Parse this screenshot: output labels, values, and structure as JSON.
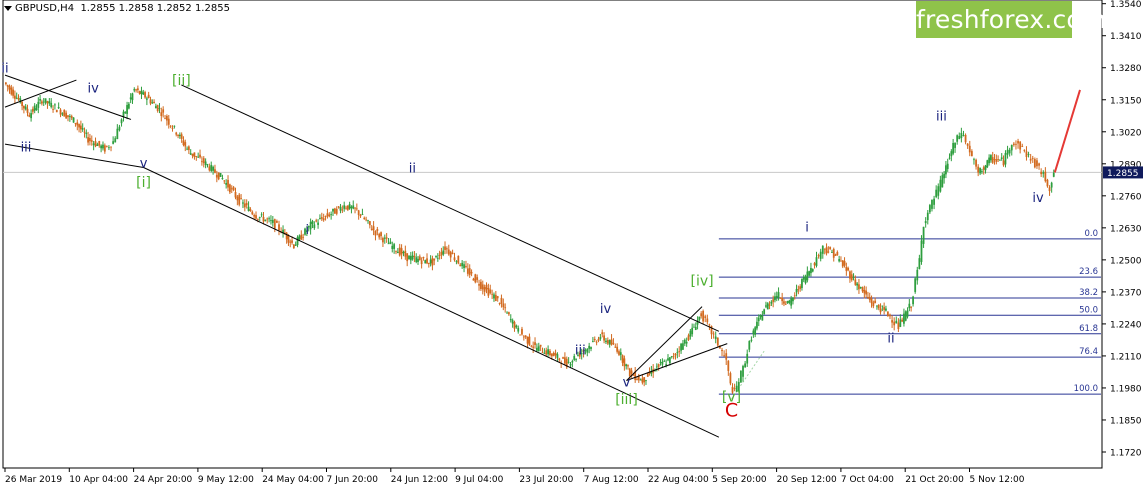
{
  "header": {
    "symbol": "GBPUSD,H4",
    "ohlc": "1.2855 1.2858 1.2852 1.2855"
  },
  "logo": {
    "text": "freshforex.com"
  },
  "colors": {
    "bull": "#2e9e3e",
    "bear": "#d2691e",
    "green_label": "#4caf2f",
    "navy_label": "#1a237e",
    "red_label": "#d50000",
    "fib_line": "#283593",
    "price_tag_bg": "#0f1a5c"
  },
  "chart_data": {
    "type": "candlestick",
    "symbol": "GBPUSD",
    "timeframe": "H4",
    "current_price": 1.2855,
    "y_range": [
      1.1655,
      1.3555
    ],
    "y_ticks": [
      "1.3540",
      "1.3410",
      "1.3280",
      "1.3150",
      "1.3020",
      "1.2890",
      "1.2760",
      "1.2630",
      "1.2500",
      "1.2370",
      "1.2240",
      "1.2110",
      "1.1980",
      "1.1850",
      "1.1720"
    ],
    "x_labels": [
      "26 Mar 2019",
      "10 Apr 04:00",
      "24 Apr 20:00",
      "9 May 12:00",
      "24 May 04:00",
      "7 Jun 20:00",
      "24 Jun 12:00",
      "9 Jul 04:00",
      "23 Jul 20:00",
      "7 Aug 12:00",
      "22 Aug 04:00",
      "5 Sep 20:00",
      "20 Sep 12:00",
      "7 Oct 04:00",
      "21 Oct 20:00",
      "5 Nov 12:00"
    ],
    "price_path": [
      [
        0,
        1.322
      ],
      [
        3,
        1.316
      ],
      [
        6,
        1.309
      ],
      [
        9,
        1.315
      ],
      [
        13,
        1.311
      ],
      [
        17,
        1.306
      ],
      [
        20,
        1.299
      ],
      [
        24,
        1.295
      ],
      [
        26,
        1.298
      ],
      [
        28,
        1.307
      ],
      [
        31,
        1.319
      ],
      [
        34,
        1.316
      ],
      [
        37,
        1.311
      ],
      [
        41,
        1.302
      ],
      [
        44,
        1.294
      ],
      [
        48,
        1.289
      ],
      [
        52,
        1.283
      ],
      [
        56,
        1.274
      ],
      [
        60,
        1.268
      ],
      [
        64,
        1.265
      ],
      [
        66,
        1.262
      ],
      [
        69,
        1.256
      ],
      [
        73,
        1.264
      ],
      [
        77,
        1.268
      ],
      [
        81,
        1.272
      ],
      [
        84,
        1.27
      ],
      [
        88,
        1.262
      ],
      [
        92,
        1.256
      ],
      [
        96,
        1.251
      ],
      [
        99,
        1.25
      ],
      [
        102,
        1.249
      ],
      [
        105,
        1.255
      ],
      [
        110,
        1.246
      ],
      [
        114,
        1.239
      ],
      [
        118,
        1.233
      ],
      [
        122,
        1.222
      ],
      [
        126,
        1.215
      ],
      [
        130,
        1.212
      ],
      [
        134,
        1.208
      ],
      [
        138,
        1.213
      ],
      [
        142,
        1.219
      ],
      [
        146,
        1.214
      ],
      [
        149,
        1.204
      ],
      [
        152,
        1.201
      ],
      [
        155,
        1.206
      ],
      [
        159,
        1.21
      ],
      [
        163,
        1.219
      ],
      [
        166,
        1.228
      ],
      [
        168,
        1.222
      ],
      [
        170,
        1.216
      ],
      [
        172,
        1.209
      ],
      [
        173,
        1.199
      ],
      [
        174,
        1.196
      ],
      [
        176,
        1.206
      ],
      [
        178,
        1.219
      ],
      [
        181,
        1.23
      ],
      [
        184,
        1.236
      ],
      [
        187,
        1.232
      ],
      [
        190,
        1.241
      ],
      [
        193,
        1.249
      ],
      [
        195,
        1.255
      ],
      [
        198,
        1.252
      ],
      [
        201,
        1.245
      ],
      [
        204,
        1.238
      ],
      [
        207,
        1.232
      ],
      [
        210,
        1.229
      ],
      [
        212,
        1.225
      ],
      [
        213,
        1.223
      ],
      [
        216,
        1.232
      ],
      [
        218,
        1.25
      ],
      [
        219,
        1.265
      ],
      [
        221,
        1.273
      ],
      [
        223,
        1.281
      ],
      [
        226,
        1.296
      ],
      [
        228,
        1.302
      ],
      [
        230,
        1.294
      ],
      [
        232,
        1.285
      ],
      [
        235,
        1.291
      ],
      [
        238,
        1.29
      ],
      [
        240,
        1.298
      ],
      [
        242,
        1.296
      ],
      [
        244,
        1.292
      ],
      [
        246,
        1.288
      ],
      [
        248,
        1.283
      ],
      [
        249,
        1.279
      ],
      [
        250,
        1.286
      ]
    ],
    "forecast": [
      [
        250,
        1.2855
      ],
      [
        256,
        1.319
      ]
    ],
    "fibonacci": [
      {
        "level": "0.0",
        "price": 1.2585
      },
      {
        "level": "23.6",
        "price": 1.243
      },
      {
        "level": "38.2",
        "price": 1.2345
      },
      {
        "level": "50.0",
        "price": 1.2275
      },
      {
        "level": "61.8",
        "price": 1.22
      },
      {
        "level": "76.4",
        "price": 1.2105
      },
      {
        "level": "100.0",
        "price": 1.1955
      }
    ],
    "wave_labels": [
      {
        "text": "ii",
        "color": "navy",
        "pt": [
          0,
          1.326
        ]
      },
      {
        "text": "iii",
        "color": "navy",
        "pt": [
          5,
          1.294
        ]
      },
      {
        "text": "iv",
        "color": "navy",
        "pt": [
          21,
          1.318
        ]
      },
      {
        "text": "v",
        "color": "navy",
        "pt": [
          33,
          1.2875
        ]
      },
      {
        "text": "[i]",
        "color": "green",
        "pt": [
          33,
          1.2795
        ]
      },
      {
        "text": "[ii]",
        "color": "green",
        "pt": [
          42,
          1.321
        ]
      },
      {
        "text": "i",
        "color": "navy",
        "pt": [
          72,
          1.2605
        ]
      },
      {
        "text": "ii",
        "color": "navy",
        "pt": [
          97,
          1.2855
        ]
      },
      {
        "text": "iii",
        "color": "navy",
        "pt": [
          137,
          1.2115
        ]
      },
      {
        "text": "iv",
        "color": "navy",
        "pt": [
          143,
          1.2285
        ]
      },
      {
        "text": "v",
        "color": "navy",
        "pt": [
          148,
          1.1985
        ]
      },
      {
        "text": "[iii]",
        "color": "green",
        "pt": [
          148,
          1.1915
        ]
      },
      {
        "text": "[iv]",
        "color": "green",
        "pt": [
          166,
          1.2395
        ]
      },
      {
        "text": "[v]",
        "color": "green",
        "pt": [
          173,
          1.1925
        ]
      },
      {
        "text": "C",
        "color": "red",
        "pt": [
          173,
          1.1865
        ]
      },
      {
        "text": "i",
        "color": "navy",
        "pt": [
          191,
          1.2615
        ]
      },
      {
        "text": "ii",
        "color": "navy",
        "pt": [
          211,
          1.2165
        ]
      },
      {
        "text": "iii",
        "color": "navy",
        "pt": [
          223,
          1.3065
        ]
      },
      {
        "text": "iv",
        "color": "navy",
        "pt": [
          246,
          1.2735
        ]
      }
    ],
    "trendlines": [
      {
        "from": [
          0,
          1.325
        ],
        "to": [
          30,
          1.307
        ]
      },
      {
        "from": [
          0,
          1.312
        ],
        "to": [
          17,
          1.323
        ]
      },
      {
        "from": [
          0,
          1.297
        ],
        "to": [
          33,
          1.2875
        ]
      },
      {
        "from": [
          42,
          1.321
        ],
        "to": [
          170,
          1.221
        ]
      },
      {
        "from": [
          33,
          1.2875
        ],
        "to": [
          170,
          1.178
        ]
      },
      {
        "from": [
          148,
          1.201
        ],
        "to": [
          166,
          1.231
        ]
      },
      {
        "from": [
          148,
          1.201
        ],
        "to": [
          172,
          1.216
        ]
      }
    ]
  }
}
